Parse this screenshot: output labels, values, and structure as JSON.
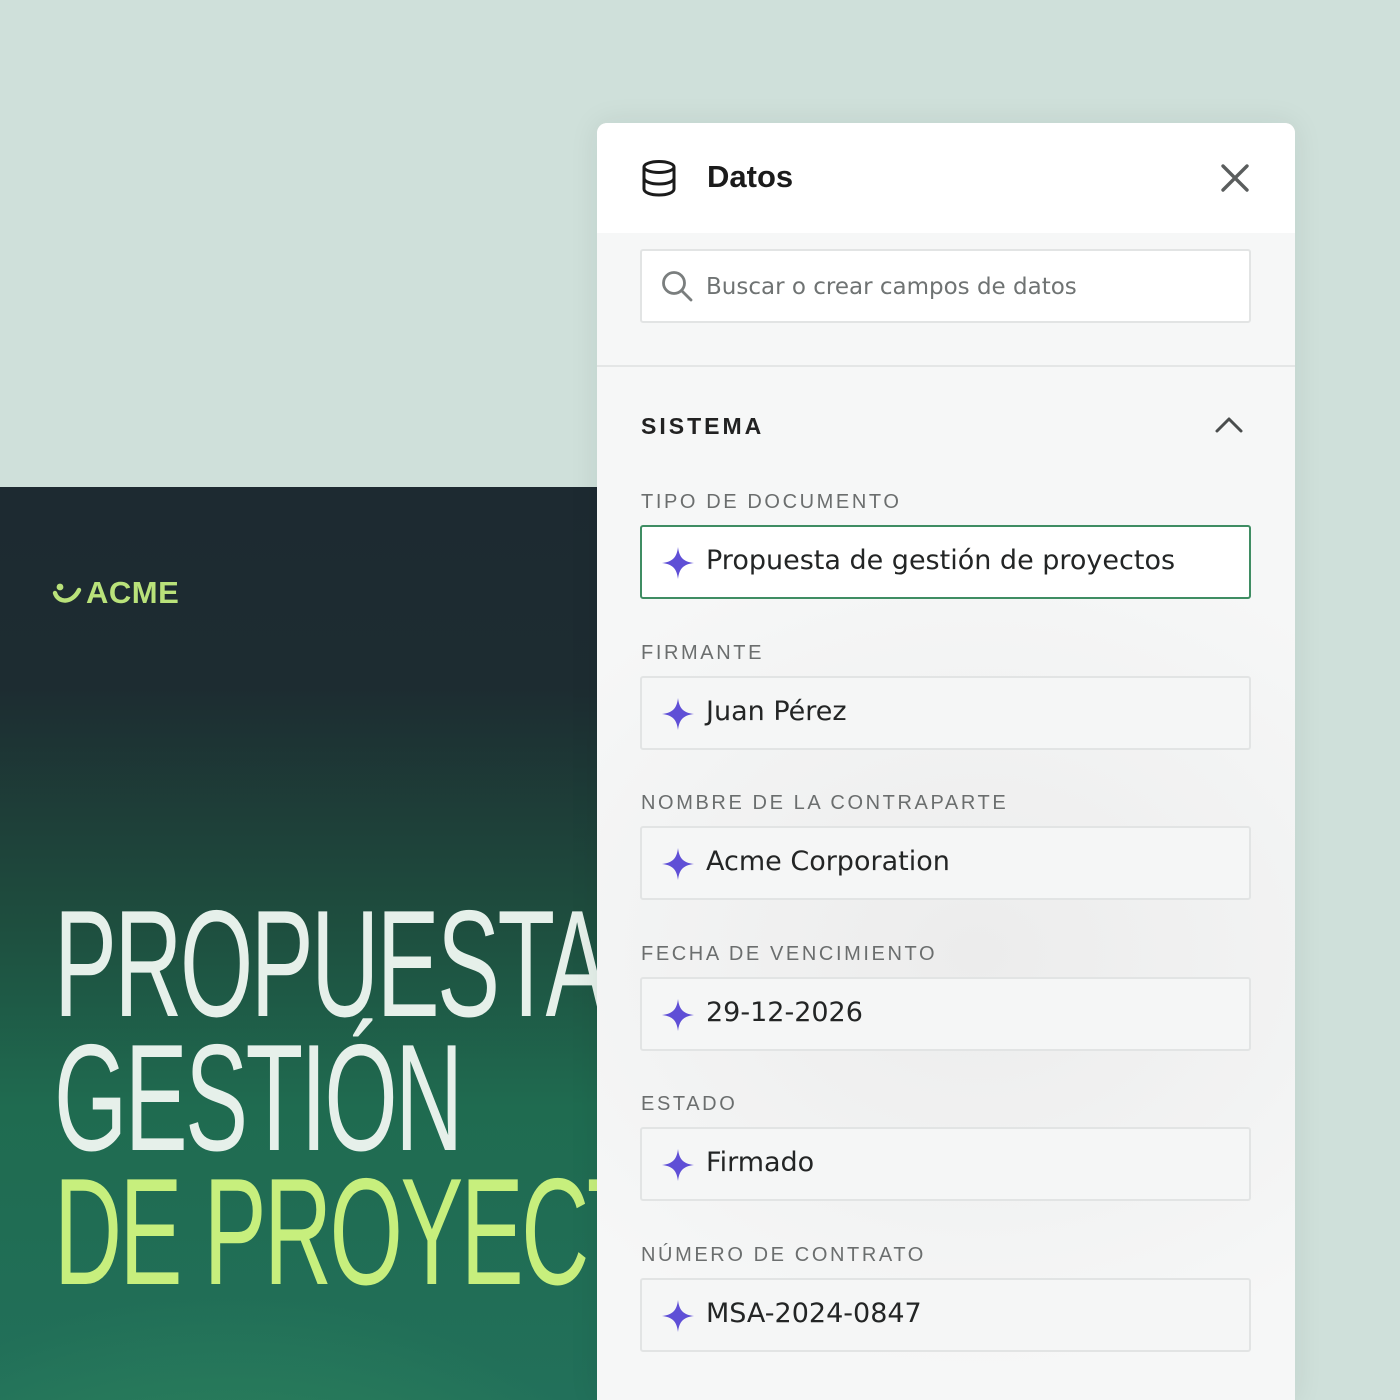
{
  "document": {
    "brand_name": "ACME",
    "title_lines": [
      "PROPUESTA",
      "GESTIÓN",
      "DE PROYECT"
    ]
  },
  "panel": {
    "title": "Datos",
    "header_icon": "database-icon",
    "close_icon": "close-icon",
    "search": {
      "placeholder": "Buscar o crear campos de datos",
      "value": "",
      "icon": "search-icon"
    },
    "section": {
      "title": "SISTEMA",
      "expanded": true,
      "toggle_icon": "chevron-up-icon",
      "fields": [
        {
          "label": "TIPO DE DOCUMENTO",
          "value": "Propuesta de gestión de proyectos",
          "active": true
        },
        {
          "label": "FIRMANTE",
          "value": "Juan Pérez",
          "active": false
        },
        {
          "label": "NOMBRE DE LA CONTRAPARTE",
          "value": "Acme Corporation",
          "active": false
        },
        {
          "label": "FECHA DE VENCIMIENTO",
          "value": "29-12-2026",
          "active": false
        },
        {
          "label": "ESTADO",
          "value": "Firmado",
          "active": false
        },
        {
          "label": "NÚMERO DE CONTRATO",
          "value": "MSA-2024-0847",
          "active": false
        }
      ]
    }
  },
  "colors": {
    "background": "#cfe0da",
    "brand_green": "#b9e27a",
    "title_light": "#e6f0ea",
    "title_accent": "#c7ef7d",
    "sparkle_purple": "#5f4fd6",
    "active_border": "#3f8d63"
  }
}
